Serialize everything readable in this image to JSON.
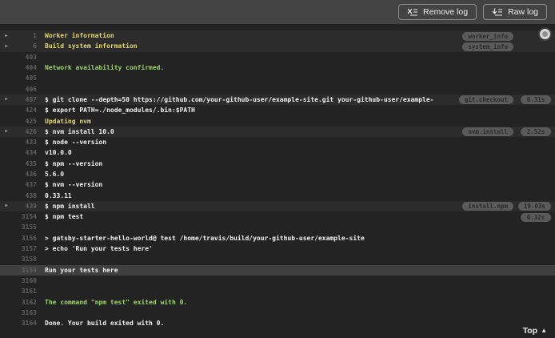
{
  "toolbar": {
    "remove_log_label": "Remove log",
    "raw_log_label": "Raw log"
  },
  "colors": {
    "toolbar_bg": "#434343",
    "log_bg": "#232323",
    "fold_row_bg": "#2c2c2c",
    "selected_row_bg": "#3f3f3f",
    "text": "#f1f1f1",
    "yellow": "#e2d56b",
    "green": "#9ed06a",
    "line_number": "#606060",
    "badge_bg": "#5a5a5a"
  },
  "log": {
    "top_link_label": "Top",
    "rows": [
      {
        "num": "1",
        "text": "Worker information",
        "style": "yellow",
        "fold": true,
        "rowbg": "fold",
        "badge": "worker_info"
      },
      {
        "num": "6",
        "text": "Build system information",
        "style": "yellow",
        "fold": true,
        "rowbg": "fold",
        "badge": "system_info"
      },
      {
        "num": "403",
        "text": ""
      },
      {
        "num": "404",
        "text": "Network availability confirmed.",
        "style": "green"
      },
      {
        "num": "405",
        "text": ""
      },
      {
        "num": "406",
        "text": ""
      },
      {
        "num": "407",
        "text": "$ git clone --depth=50 https://github.com/your-github-user/example-site.git your-github-user/example-",
        "fold": true,
        "rowbg": "fold",
        "badge": "git.checkout",
        "timing": "0.31s"
      },
      {
        "num": "424",
        "text": "$ export PATH=./node_modules/.bin:$PATH"
      },
      {
        "num": "425",
        "text": "Updating nvm",
        "style": "yellow"
      },
      {
        "num": "426",
        "text": "$ nvm install 10.0",
        "fold": true,
        "rowbg": "fold",
        "badge": "nvm.install",
        "timing": "2.52s"
      },
      {
        "num": "433",
        "text": "$ node --version"
      },
      {
        "num": "434",
        "text": "v10.0.0"
      },
      {
        "num": "435",
        "text": "$ npm --version"
      },
      {
        "num": "436",
        "text": "5.6.0"
      },
      {
        "num": "437",
        "text": "$ nvm --version"
      },
      {
        "num": "438",
        "text": "0.33.11"
      },
      {
        "num": "439",
        "text": "$ npm install",
        "fold": true,
        "rowbg": "fold",
        "badge": "install.npm",
        "timing": "19.03s"
      },
      {
        "num": "3154",
        "text": "$ npm test",
        "timing": "0.32s"
      },
      {
        "num": "3155",
        "text": ""
      },
      {
        "num": "3156",
        "text": "> gatsby-starter-hello-world@ test /home/travis/build/your-github-user/example-site"
      },
      {
        "num": "3157",
        "text": "> echo 'Run your tests here'"
      },
      {
        "num": "3158",
        "text": ""
      },
      {
        "num": "3159",
        "text": "Run your tests here",
        "rowbg": "selected"
      },
      {
        "num": "3160",
        "text": ""
      },
      {
        "num": "3161",
        "text": ""
      },
      {
        "num": "3162",
        "text": "The command \"npm test\" exited with 0.",
        "style": "green"
      },
      {
        "num": "3163",
        "text": ""
      },
      {
        "num": "3164",
        "text": "Done. Your build exited with 0."
      }
    ]
  }
}
